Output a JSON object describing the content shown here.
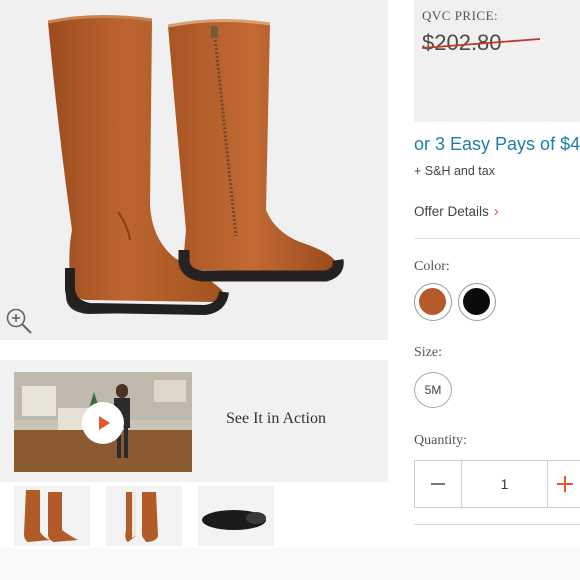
{
  "product": {
    "image_alt": "Tall suede boots, cognac",
    "zoom_icon": "magnifier-plus-icon"
  },
  "video": {
    "label": "See It in Action",
    "play_icon": "play-icon"
  },
  "thumbnails": [
    {
      "name": "thumb-boots-side"
    },
    {
      "name": "thumb-boots-back"
    },
    {
      "name": "thumb-boot-sole"
    }
  ],
  "price": {
    "label": "QVC PRICE:",
    "original": "$202.80"
  },
  "easy_pay": {
    "text": "or 3 Easy Pays of $4"
  },
  "shipping": {
    "text": "+ S&H and tax"
  },
  "offer": {
    "label": "Offer Details",
    "arrow": "›"
  },
  "color": {
    "label": "Color:",
    "options": [
      {
        "name": "cognac",
        "hex": "#b65a2a"
      },
      {
        "name": "black",
        "hex": "#0b0b0b"
      }
    ]
  },
  "size": {
    "label": "Size:",
    "options": [
      "5M"
    ]
  },
  "quantity": {
    "label": "Quantity:",
    "value": "1",
    "minus_icon": "minus-icon",
    "plus_icon": "plus-icon"
  },
  "colors": {
    "link_blue": "#1d7fa8",
    "accent_orange": "#e4572e",
    "strike_red": "#c0392b"
  }
}
